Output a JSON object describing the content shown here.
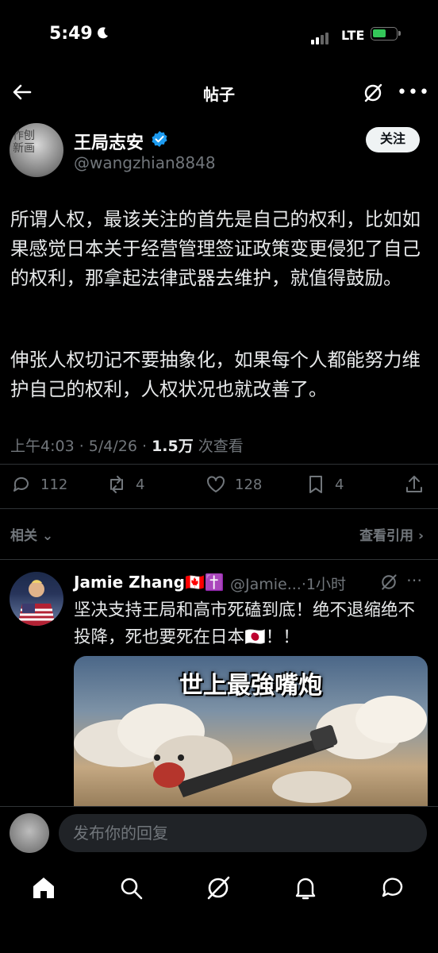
{
  "status": {
    "time": "5:49",
    "network": "LTE"
  },
  "header": {
    "title": "帖子"
  },
  "post": {
    "author_name": "王局志安",
    "handle": "@wangzhian8848",
    "follow_label": "关注",
    "paragraphs": [
      "所谓人权，最该关注的首先是自己的权利，比如如果感觉日本关于经营管理签证政策变更侵犯了自己的权利，那拿起法律武器去维护，就值得鼓励。",
      "伸张人权切记不要抽象化，如果每个人都能努力维护自己的权利，人权状况也就改善了。"
    ],
    "timestamp": "上午4:03 · 5/4/26 · ",
    "views_count": "1.5万",
    "views_label": " 次查看",
    "stats": {
      "replies": "112",
      "reposts": "4",
      "likes": "128",
      "bookmarks": "4"
    }
  },
  "related": {
    "label": "相关",
    "quotes_label": "查看引用"
  },
  "reply": {
    "name": "Jamie Zhang🇨🇦✝️",
    "handle": "@Jamie...·1小时",
    "text": "坚决支持王局和高市死磕到底！绝不退缩绝不投降，死也要死在日本🇯🇵！！",
    "media_caption": "世上最強嘴炮"
  },
  "composer": {
    "placeholder": "发布你的回复"
  },
  "icons": {
    "back": "arrow-left-icon",
    "grok": "grok-icon",
    "more": "more-dots-icon",
    "verified": "verified-badge-icon",
    "reply": "reply-icon",
    "repost": "repost-icon",
    "like": "heart-icon",
    "bookmark": "bookmark-icon",
    "share": "share-icon",
    "home": "home-icon",
    "search": "search-icon",
    "notifications": "bell-icon",
    "messages": "messages-icon"
  },
  "colors": {
    "background": "#000000",
    "text": "#e7e9ea",
    "muted": "#71767b",
    "verified": "#1d9bf0",
    "battery": "#34c759"
  }
}
